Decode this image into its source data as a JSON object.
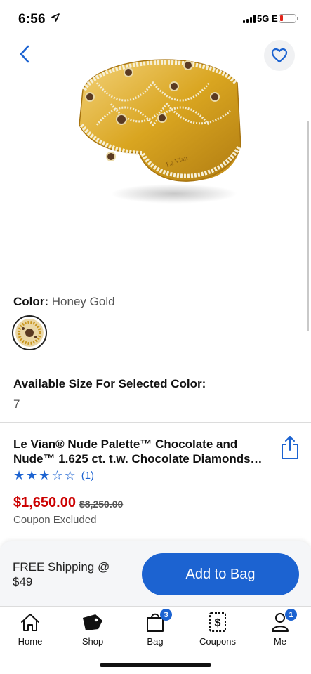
{
  "status_bar": {
    "time": "6:56",
    "network": "5G E",
    "battery_color": "#e1251b"
  },
  "header": {
    "back_icon": "chevron-left-icon",
    "favorite_icon": "heart-outline-icon"
  },
  "product": {
    "image_alt": "gold ring with chocolate and white diamonds",
    "color_label": "Color:",
    "color_value": "Honey Gold",
    "size_title": "Available Size For Selected Color:",
    "size_value": "7",
    "title_line1": "Le Vian® Nude Palette™ Chocolate and",
    "title_line2": "Nude™ 1.625 ct. t.w. Chocolate Diamonds…",
    "rating": 3,
    "rating_max": 5,
    "rating_count": "(1)",
    "price": "$1,650.00",
    "original_price": "$8,250.00",
    "coupon_note": "Coupon Excluded"
  },
  "action_bar": {
    "shipping_text": "FREE Shipping @ $49",
    "add_button_label": "Add to Bag"
  },
  "tab_bar": {
    "items": [
      {
        "label": "Home",
        "icon": "home-icon"
      },
      {
        "label": "Shop",
        "icon": "tag-icon"
      },
      {
        "label": "Bag",
        "icon": "shopping-bag-icon",
        "badge": "3"
      },
      {
        "label": "Coupons",
        "icon": "coupon-icon"
      },
      {
        "label": "Me",
        "icon": "person-icon",
        "badge": "1"
      }
    ]
  },
  "colors": {
    "accent": "#1c63d1",
    "price_red": "#cc0000",
    "gold": "#d9a520"
  }
}
